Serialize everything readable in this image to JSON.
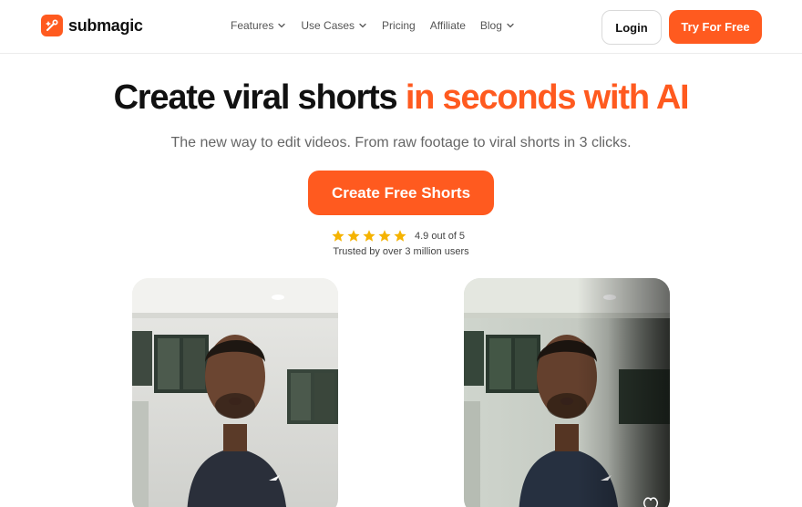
{
  "brand": {
    "name": "submagic",
    "accent": "#ff5a1f"
  },
  "nav": {
    "items": [
      {
        "label": "Features",
        "has_dropdown": true
      },
      {
        "label": "Use Cases",
        "has_dropdown": true
      },
      {
        "label": "Pricing",
        "has_dropdown": false
      },
      {
        "label": "Affiliate",
        "has_dropdown": false
      },
      {
        "label": "Blog",
        "has_dropdown": true
      }
    ],
    "login_label": "Login",
    "try_label": "Try For Free"
  },
  "hero": {
    "title_dark": "Create viral shorts",
    "title_accent": "in seconds with AI",
    "subtitle": "The new way to edit videos. From raw footage to viral shorts in 3 clicks.",
    "cta_label": "Create Free Shorts",
    "rating": {
      "stars": 5,
      "text": "4.9 out of 5",
      "trusted": "Trusted by over 3 million users"
    }
  },
  "icons": {
    "logo": "submagic-logo-icon",
    "chevron": "chevron-down-icon",
    "star": "star-icon",
    "heart": "heart-icon"
  },
  "videos": [
    {
      "name": "video-before",
      "style": "raw"
    },
    {
      "name": "video-after",
      "style": "edited"
    }
  ]
}
